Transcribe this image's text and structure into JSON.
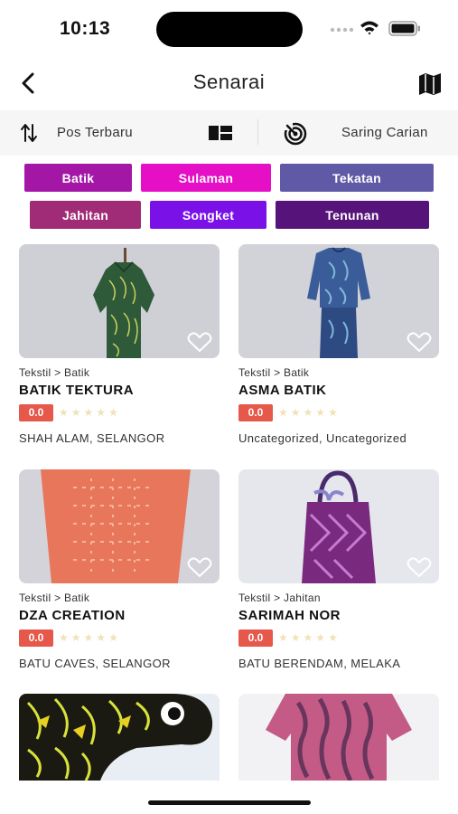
{
  "status_bar": {
    "time": "10:13"
  },
  "header": {
    "title": "Senarai"
  },
  "toolbar": {
    "sort_label": "Pos Terbaru",
    "filter_label": "Saring Carian"
  },
  "categories": [
    {
      "label": "Batik",
      "color": "#a316a6"
    },
    {
      "label": "Sulaman",
      "color": "#e50fc6"
    },
    {
      "label": "Tekatan",
      "color": "#5f59a6"
    },
    {
      "label": "Jahitan",
      "color": "#a02b76"
    },
    {
      "label": "Songket",
      "color": "#7a12e8"
    },
    {
      "label": "Tenunan",
      "color": "#56137a"
    }
  ],
  "products": [
    {
      "category": "Tekstil > Batik",
      "name": "BATIK TEKTURA",
      "rating": "0.0",
      "location": "SHAH ALAM, SELANGOR"
    },
    {
      "category": "Tekstil > Batik",
      "name": "ASMA BATIK",
      "rating": "0.0",
      "location": "Uncategorized, Uncategorized"
    },
    {
      "category": "Tekstil > Batik",
      "name": "DZA CREATION",
      "rating": "0.0",
      "location": "BATU CAVES, SELANGOR"
    },
    {
      "category": "Tekstil > Jahitan",
      "name": "SARIMAH NOR",
      "rating": "0.0",
      "location": "BATU BERENDAM, MELAKA"
    }
  ],
  "colors": {
    "rating_badge": "#e5584a",
    "star_empty": "#f0e2b8"
  },
  "icons": [
    "back-arrow-icon",
    "map-icon",
    "sort-icon",
    "layout-grid-icon",
    "filter-radar-icon",
    "heart-icon"
  ]
}
